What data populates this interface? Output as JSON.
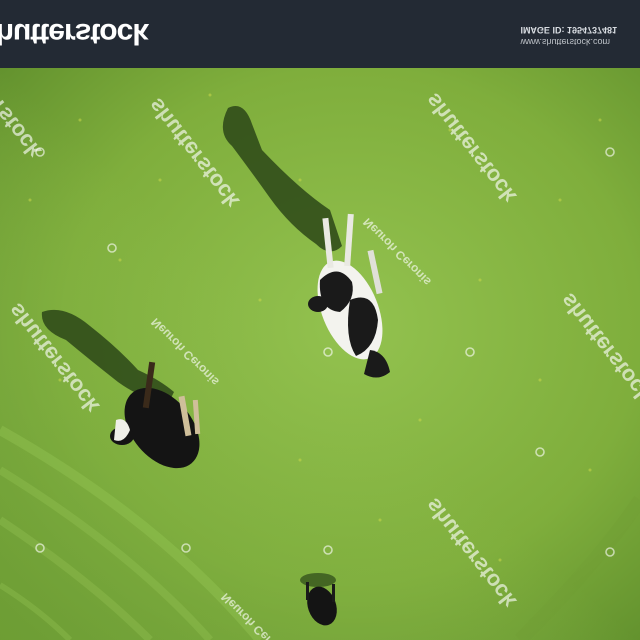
{
  "header": {
    "logo_text": "shutterstock",
    "site": "www.shutterstock.com",
    "image_id": "IMAGE ID: 1954737481"
  },
  "watermarks": {
    "brand": "shutterstock",
    "credit": "Neuroh Ceronis"
  },
  "colors": {
    "header_bg": "#232a34",
    "grass_light": "#8fbe4c",
    "grass_dark": "#5f8f2d",
    "shadow": "#1e3412"
  },
  "scene": {
    "subject": "aerial view of three cows grazing on a green pasture, image shown upside-down"
  }
}
